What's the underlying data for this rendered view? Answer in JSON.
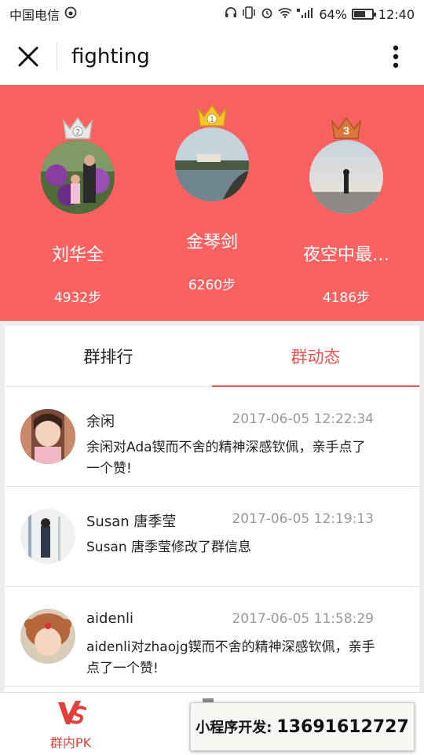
{
  "status_bar": {
    "carrier": "中国电信",
    "battery": "64%",
    "battery_level": 0.64,
    "time": "12:40"
  },
  "nav": {
    "title": "fighting",
    "close_icon": "close-icon",
    "more_icon": "more-vertical-icon"
  },
  "podium": {
    "background": "#f96260",
    "ranks": [
      {
        "rank": 2,
        "name": "刘华全",
        "steps": "4932步",
        "crown_color": "#e8e8e8",
        "crown_number": "2"
      },
      {
        "rank": 1,
        "name": "金琴剑",
        "steps": "6260步",
        "crown_color": "#f4c430",
        "crown_number": "1"
      },
      {
        "rank": 3,
        "name": "夜空中最…",
        "steps": "4186步",
        "crown_color": "#d9783a",
        "crown_number": "3"
      }
    ]
  },
  "tabs": [
    {
      "label": "群排行",
      "active": false
    },
    {
      "label": "群动态",
      "active": true
    }
  ],
  "accent": "#f0524f",
  "feed": [
    {
      "name": "余闲",
      "time": "2017-06-05 12:22:34",
      "text": "余闲对Ada锲而不舍的精神深感钦佩，亲手点了一个赞!"
    },
    {
      "name": "Susan 唐季莹",
      "time": "2017-06-05 12:19:13",
      "text": "Susan 唐季莹修改了群信息"
    },
    {
      "name": "aidenli",
      "time": "2017-06-05 11:58:29",
      "text": "aidenli对zhaojg锲而不舍的精神深感钦佩，亲手点了一个赞!"
    }
  ],
  "bottom_bar": {
    "tab_label": "群内PK",
    "tab_icon": "vs-icon"
  },
  "promo": {
    "label": "小程序开发:",
    "phone": "13691612727"
  }
}
